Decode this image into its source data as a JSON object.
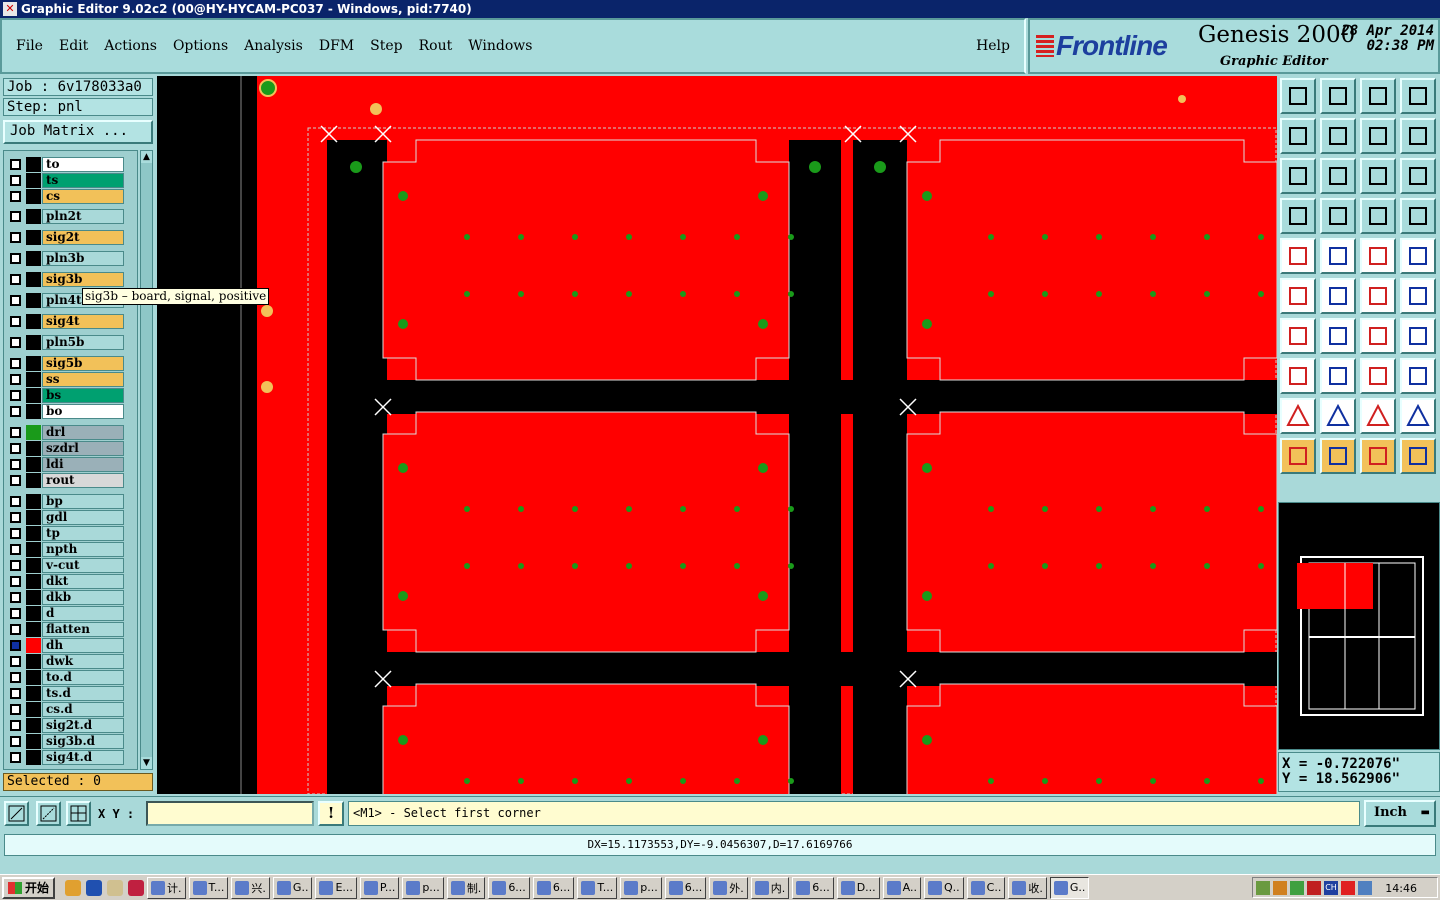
{
  "window": {
    "title": "Graphic Editor 9.02c2 (00@HY-HYCAM-PC037 - Windows, pid:7740)"
  },
  "menu": [
    "File",
    "Edit",
    "Actions",
    "Options",
    "Analysis",
    "DFM",
    "Step",
    "Rout",
    "Windows"
  ],
  "help_label": "Help",
  "brand": {
    "logo": "Frontline",
    "product": "Genesis 2000",
    "subtitle": "Graphic Editor",
    "date": "28 Apr 2014",
    "time": "02:38 PM"
  },
  "job": {
    "job_line": "Job : 6v178033a0",
    "step_line": "Step: pnl",
    "job_matrix_label": "Job Matrix ..."
  },
  "layers": [
    {
      "name": "to",
      "color": "#ffffff"
    },
    {
      "name": "ts",
      "color": "#00a070"
    },
    {
      "name": "cs",
      "color": "#f2c159"
    },
    {
      "name": "pln2t",
      "color": "#a9d9d9"
    },
    {
      "name": "sig2t",
      "color": "#f2c159"
    },
    {
      "name": "pln3b",
      "color": "#a9d9d9"
    },
    {
      "name": "sig3b",
      "color": "#f2c159"
    },
    {
      "name": "pln4t",
      "color": "#a9d9d9"
    },
    {
      "name": "sig4t",
      "color": "#f2c159"
    },
    {
      "name": "pln5b",
      "color": "#a9d9d9"
    },
    {
      "name": "sig5b",
      "color": "#f2c159"
    },
    {
      "name": "ss",
      "color": "#f2c159"
    },
    {
      "name": "bs",
      "color": "#00a070"
    },
    {
      "name": "bo",
      "color": "#ffffff"
    },
    {
      "name": "drl",
      "color": "#9ab0b8"
    },
    {
      "name": "szdrl",
      "color": "#9ab0b8"
    },
    {
      "name": "ldi",
      "color": "#9ab0b8"
    },
    {
      "name": "rout",
      "color": "#d8d8d8"
    },
    {
      "name": "bp",
      "color": "#a9d9d9"
    },
    {
      "name": "gdl",
      "color": "#a9d9d9"
    },
    {
      "name": "tp",
      "color": "#a9d9d9"
    },
    {
      "name": "npth",
      "color": "#a9d9d9"
    },
    {
      "name": "v-cut",
      "color": "#a9d9d9"
    },
    {
      "name": "dkt",
      "color": "#a9d9d9"
    },
    {
      "name": "dkb",
      "color": "#a9d9d9"
    },
    {
      "name": "d",
      "color": "#a9d9d9"
    },
    {
      "name": "flatten",
      "color": "#a9d9d9"
    },
    {
      "name": "dh",
      "color": "#a9d9d9"
    },
    {
      "name": "dwk",
      "color": "#a9d9d9"
    },
    {
      "name": "to.d",
      "color": "#a9d9d9"
    },
    {
      "name": "ts.d",
      "color": "#a9d9d9"
    },
    {
      "name": "cs.d",
      "color": "#a9d9d9"
    },
    {
      "name": "sig2t.d",
      "color": "#a9d9d9"
    },
    {
      "name": "sig3b.d",
      "color": "#a9d9d9"
    },
    {
      "name": "sig4t.d",
      "color": "#a9d9d9"
    }
  ],
  "tooltip": "sig3b – board, signal, positive",
  "selected": "Selected : 0",
  "coords": {
    "x": "X = -0.722076\"",
    "y": "Y = 18.562906\""
  },
  "cmd": {
    "xy_label": "X Y :",
    "warn": "!",
    "prompt": "<M1> - Select first corner",
    "units": "Inch"
  },
  "status": "DX=15.1173553,DY=-9.0456307,D=17.6169766",
  "taskbar": {
    "start": "开始",
    "items": [
      "计.",
      "T...",
      "兴.",
      "G..",
      "E...",
      "P...",
      "p...",
      "制.",
      "6...",
      "6...",
      "T...",
      "p...",
      "6...",
      "外.",
      "内.",
      "6...",
      "D...",
      "A..",
      "Q..",
      "C..",
      "收.",
      "G.."
    ],
    "ime": "CH",
    "clock": "14:46"
  },
  "colors": {
    "board": "#ff0000",
    "pad": "#1a9a1a",
    "bg": "#000000",
    "panel": "#a9d9d9",
    "accent": "#f2c159"
  }
}
